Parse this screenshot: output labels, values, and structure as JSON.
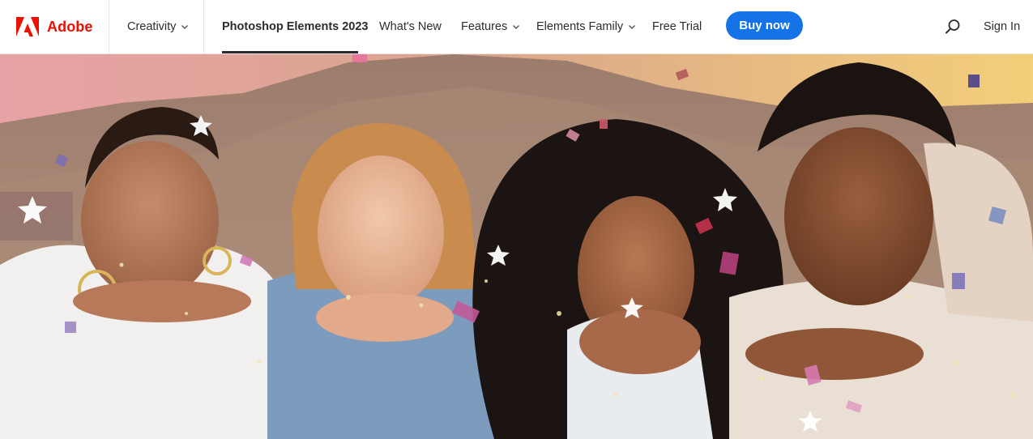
{
  "brand": {
    "name": "Adobe",
    "color": "#eb1000"
  },
  "nav": {
    "creativity": "Creativity",
    "product": "Photoshop Elements 2023",
    "whats_new": "What's New",
    "features": "Features",
    "family": "Elements Family",
    "free_trial": "Free Trial",
    "buy_now": "Buy now",
    "sign_in": "Sign In",
    "search_icon": "search-icon",
    "accent": "#1473e6"
  },
  "hero": {
    "image": "friends-blowing-confetti-photo"
  }
}
